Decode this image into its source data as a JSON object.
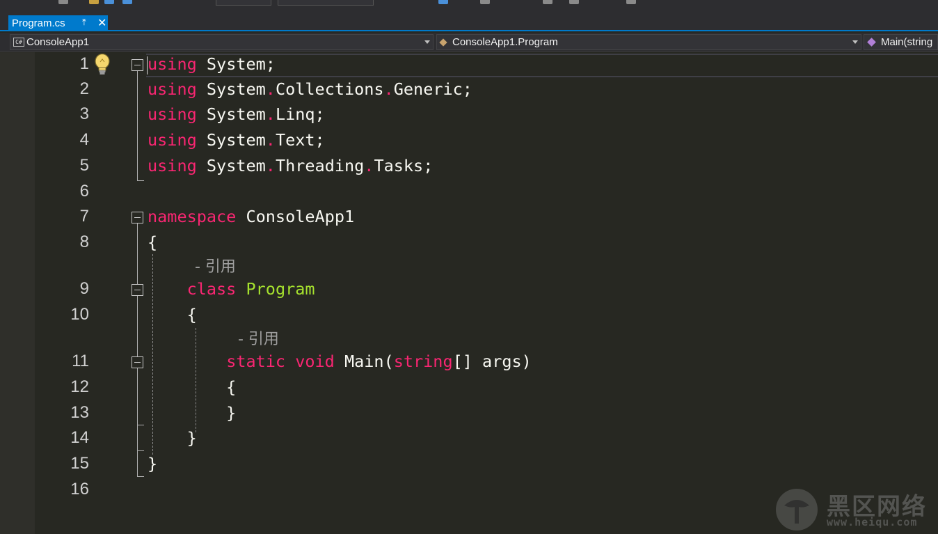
{
  "tab": {
    "label": "Program.cs",
    "pin_glyph": "⤒",
    "close_glyph": "✕"
  },
  "navbar": {
    "project": "ConsoleApp1",
    "class": "ConsoleApp1.Program",
    "member": "Main(string"
  },
  "editor": {
    "lines": [
      {
        "n": "1",
        "tokens": [
          [
            "kw",
            "using"
          ],
          [
            "plain",
            " System;"
          ]
        ]
      },
      {
        "n": "2",
        "tokens": [
          [
            "kw",
            "using"
          ],
          [
            "plain",
            " System"
          ],
          [
            "dot",
            "."
          ],
          [
            "plain",
            "Collections"
          ],
          [
            "dot",
            "."
          ],
          [
            "plain",
            "Generic;"
          ]
        ]
      },
      {
        "n": "3",
        "tokens": [
          [
            "kw",
            "using"
          ],
          [
            "plain",
            " System"
          ],
          [
            "dot",
            "."
          ],
          [
            "plain",
            "Linq;"
          ]
        ]
      },
      {
        "n": "4",
        "tokens": [
          [
            "kw",
            "using"
          ],
          [
            "plain",
            " System"
          ],
          [
            "dot",
            "."
          ],
          [
            "plain",
            "Text;"
          ]
        ]
      },
      {
        "n": "5",
        "tokens": [
          [
            "kw",
            "using"
          ],
          [
            "plain",
            " System"
          ],
          [
            "dot",
            "."
          ],
          [
            "plain",
            "Threading"
          ],
          [
            "dot",
            "."
          ],
          [
            "plain",
            "Tasks;"
          ]
        ]
      },
      {
        "n": "6",
        "tokens": []
      },
      {
        "n": "7",
        "tokens": [
          [
            "kw",
            "namespace"
          ],
          [
            "plain",
            " ConsoleApp1"
          ]
        ]
      },
      {
        "n": "8",
        "tokens": [
          [
            "plain",
            "{"
          ]
        ]
      },
      {
        "n": "9",
        "tokens": [
          [
            "plain",
            "    "
          ],
          [
            "kw",
            "class"
          ],
          [
            "plain",
            " "
          ],
          [
            "cls",
            "Program"
          ]
        ]
      },
      {
        "n": "10",
        "tokens": [
          [
            "plain",
            "    {"
          ]
        ]
      },
      {
        "n": "11",
        "tokens": [
          [
            "plain",
            "        "
          ],
          [
            "kw",
            "static"
          ],
          [
            "plain",
            " "
          ],
          [
            "kw",
            "void"
          ],
          [
            "plain",
            " Main("
          ],
          [
            "kw",
            "string"
          ],
          [
            "plain",
            "[] args)"
          ]
        ]
      },
      {
        "n": "12",
        "tokens": [
          [
            "plain",
            "        {"
          ]
        ]
      },
      {
        "n": "13",
        "tokens": [
          [
            "plain",
            "        }"
          ]
        ]
      },
      {
        "n": "14",
        "tokens": [
          [
            "plain",
            "    }"
          ]
        ]
      },
      {
        "n": "15",
        "tokens": [
          [
            "plain",
            "}"
          ]
        ]
      },
      {
        "n": "16",
        "tokens": []
      }
    ],
    "codelens": [
      "- 引用",
      "- 引用"
    ]
  },
  "icons": {
    "lightbulb": "lightbulb-icon",
    "collapse": "collapse-box-icon",
    "csharp": "csharp-file-icon",
    "class": "class-icon",
    "method": "method-icon"
  },
  "watermark": {
    "text": "黑区网络",
    "url": "www.heiqu.com"
  },
  "colors": {
    "background": "#272822",
    "keyword": "#f92672",
    "class_name": "#a6e22e",
    "text": "#f8f8f2",
    "tab_accent": "#007acc"
  }
}
